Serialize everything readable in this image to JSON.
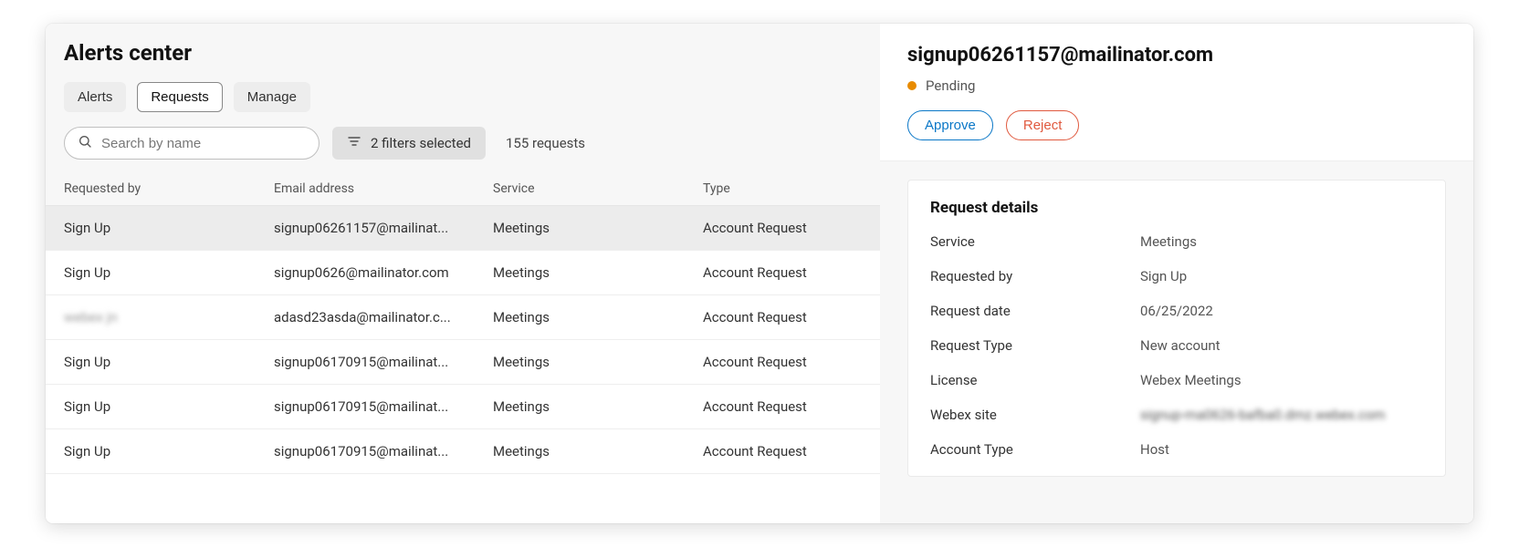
{
  "page_title": "Alerts center",
  "tabs": [
    {
      "label": "Alerts",
      "active": false
    },
    {
      "label": "Requests",
      "active": true
    },
    {
      "label": "Manage",
      "active": false
    }
  ],
  "search": {
    "placeholder": "Search by name",
    "value": ""
  },
  "filters_selected_label": "2 filters selected",
  "requests_count_label": "155 requests",
  "columns": {
    "requested_by": "Requested by",
    "email": "Email address",
    "service": "Service",
    "type": "Type"
  },
  "rows": [
    {
      "requested_by": "Sign Up",
      "email": "signup06261157@mailinat...",
      "service": "Meetings",
      "type": "Account Request",
      "selected": true,
      "blurred": false
    },
    {
      "requested_by": "Sign Up",
      "email": "signup0626@mailinator.com",
      "service": "Meetings",
      "type": "Account Request",
      "selected": false,
      "blurred": false
    },
    {
      "requested_by": "webex jn",
      "email": "adasd23asda@mailinator.c...",
      "service": "Meetings",
      "type": "Account Request",
      "selected": false,
      "blurred": true
    },
    {
      "requested_by": "Sign Up",
      "email": "signup06170915@mailinat...",
      "service": "Meetings",
      "type": "Account Request",
      "selected": false,
      "blurred": false
    },
    {
      "requested_by": "Sign Up",
      "email": "signup06170915@mailinat...",
      "service": "Meetings",
      "type": "Account Request",
      "selected": false,
      "blurred": false
    },
    {
      "requested_by": "Sign Up",
      "email": "signup06170915@mailinat...",
      "service": "Meetings",
      "type": "Account Request",
      "selected": false,
      "blurred": false
    }
  ],
  "detail": {
    "title": "signup06261157@mailinator.com",
    "status_label": "Pending",
    "status_color": "#e88b00",
    "approve_label": "Approve",
    "reject_label": "Reject",
    "section_title": "Request details",
    "fields": {
      "service": {
        "label": "Service",
        "value": "Meetings"
      },
      "requested_by": {
        "label": "Requested by",
        "value": "Sign Up"
      },
      "request_date": {
        "label": "Request date",
        "value": "06/25/2022"
      },
      "request_type": {
        "label": "Request Type",
        "value": "New account"
      },
      "license": {
        "label": "License",
        "value": "Webex Meetings"
      },
      "webex_site": {
        "label": "Webex site",
        "value": "signup-ma0626-bafba0.dmz.webex.com",
        "blurred": true
      },
      "account_type": {
        "label": "Account Type",
        "value": "Host"
      }
    }
  }
}
